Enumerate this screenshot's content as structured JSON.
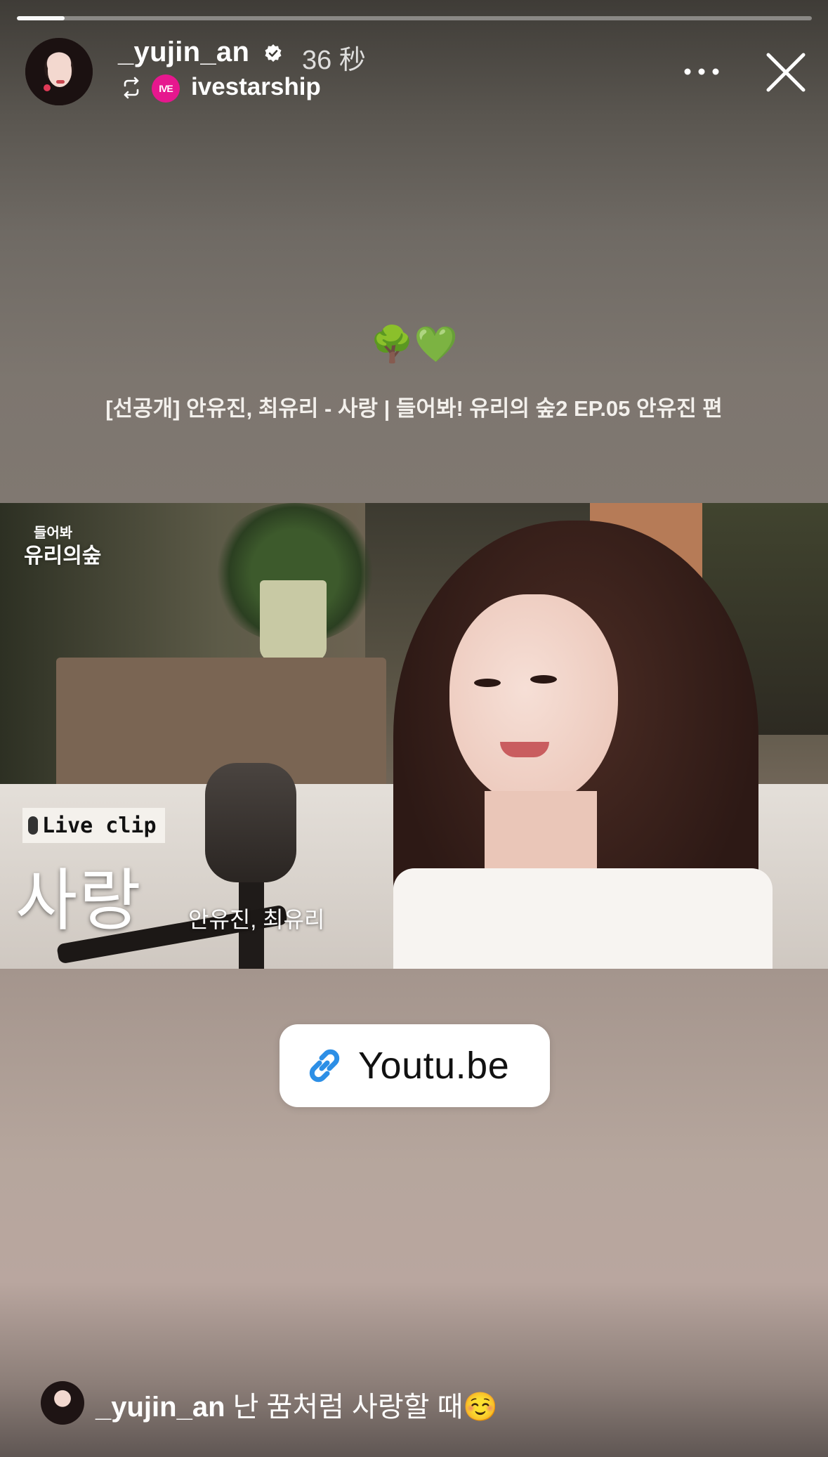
{
  "story": {
    "progress_fraction": 0.06
  },
  "header": {
    "username": "_yujin_an",
    "time_ago": "36 秒",
    "reposted_from": "ivestarship",
    "badge_text": "IVE",
    "icons": [
      "verified-icon",
      "repost-icon",
      "more-icon",
      "close-icon"
    ]
  },
  "caption": {
    "emoji": "🌳💚",
    "video_title": "[선공개] 안유진, 최유리 - 사랑 | 들어봐! 유리의 숲2 EP.05 안유진 편"
  },
  "thumbnail": {
    "show_logo_small": "들어봐",
    "show_logo_big": "유리의숲",
    "badge": "Live clip",
    "song_title": "사랑",
    "artists": "안유진, 최유리"
  },
  "link_sticker": {
    "label": "Youtu.be",
    "icon": "link-icon",
    "accent_color": "#2d8fe6"
  },
  "footer": {
    "username": "_yujin_an",
    "text": " 난 꿈처럼 사랑할 때☺️"
  },
  "colors": {
    "ive_badge": "#e6178e"
  }
}
